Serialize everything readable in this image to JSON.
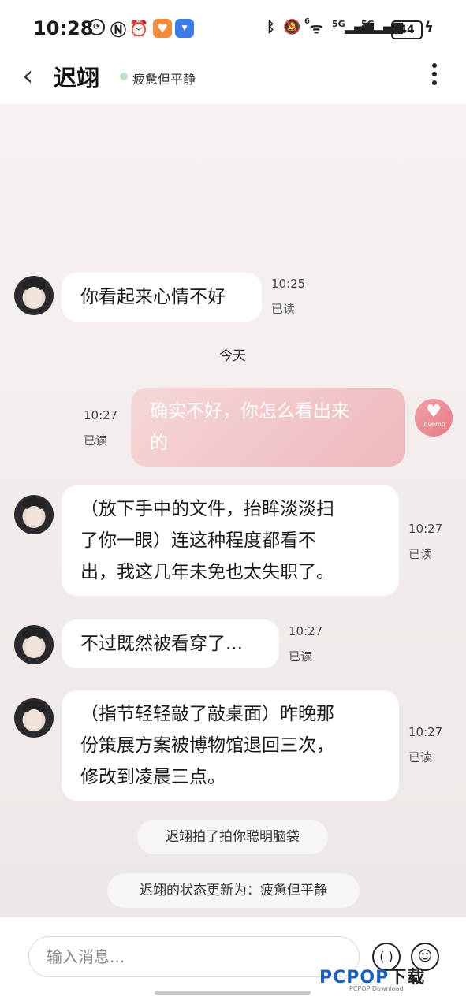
{
  "status_bar": {
    "time": "10:28",
    "network_1": "6",
    "network_2": "5G",
    "network_3": "5G",
    "battery": "44"
  },
  "header": {
    "title": "迟翊",
    "status": "疲惫但平静"
  },
  "messages": [
    {
      "side": "in",
      "lines": [
        "你看起来心情不好"
      ],
      "time": "10:25",
      "read": "已读"
    },
    {
      "side": "divider",
      "text": "今天"
    },
    {
      "side": "out",
      "lines": [
        "确实不好，你怎么看出来",
        "的"
      ],
      "time": "10:27",
      "read": "已读"
    },
    {
      "side": "in",
      "lines": [
        "（放下手中的文件，抬眸淡淡扫",
        "了你一眼）连这种程度都看不",
        "出，我这几年未免也太失职了。"
      ],
      "time": "10:27",
      "read": "已读"
    },
    {
      "side": "in",
      "lines": [
        "不过既然被看穿了..."
      ],
      "time": "10:27",
      "read": "已读"
    },
    {
      "side": "in",
      "lines": [
        "（指节轻轻敲了敲桌面）昨晚那",
        "份策展方案被博物馆退回三次，",
        "修改到凌晨三点。"
      ],
      "time": "10:27",
      "read": "已读"
    }
  ],
  "system_notices": [
    "迟翊拍了拍你聪明脑袋",
    "迟翊的状态更新为：疲惫但平静"
  ],
  "sent_avatar": {
    "text": "lovemo"
  },
  "input": {
    "placeholder": "输入消息..."
  },
  "watermark": {
    "brand_a": "PCPOP",
    "brand_b": "下载",
    "sub": "PCPOP Download"
  },
  "colors": {
    "outgoing_bubble": "#eeb9bd",
    "incoming_bubble": "#ffffff",
    "online_dot": "#bfe3c8"
  }
}
